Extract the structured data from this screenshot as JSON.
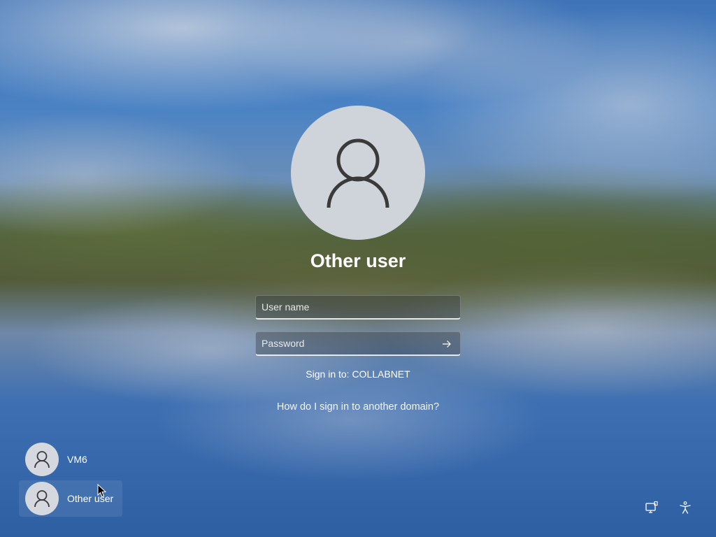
{
  "current_user": {
    "name": "Other user",
    "avatar_icon": "user-silhouette-icon"
  },
  "login_form": {
    "username_placeholder": "User name",
    "password_placeholder": "Password",
    "submit_icon": "arrow-right-icon",
    "sign_in_to": "Sign in to: COLLABNET",
    "domain_help_link": "How do I sign in to another domain?"
  },
  "user_list": [
    {
      "name": "VM6",
      "selected": false
    },
    {
      "name": "Other user",
      "selected": true
    }
  ],
  "corner_controls": {
    "network_icon": "network-icon",
    "accessibility_icon": "accessibility-icon"
  }
}
